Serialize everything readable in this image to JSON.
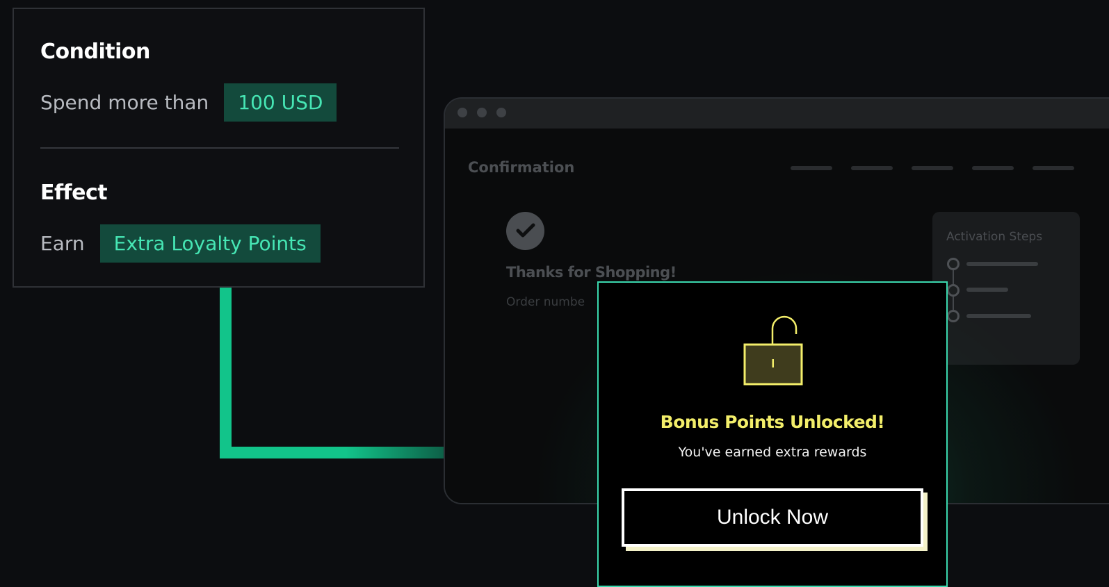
{
  "rule": {
    "condition_heading": "Condition",
    "condition_text": "Spend more than",
    "condition_value": "100 USD",
    "effect_heading": "Effect",
    "effect_text": "Earn",
    "effect_value": "Extra Loyalty Points"
  },
  "browser": {
    "page_title": "Confirmation",
    "confirmation_icon": "check-icon",
    "thanks_message": "Thanks for Shopping!",
    "order_label": "Order numbe",
    "steps_panel": {
      "title": "Activation Steps"
    }
  },
  "modal": {
    "icon": "unlocked-padlock-icon",
    "title": "Bonus Points Unlocked!",
    "subtitle": "You've earned extra rewards",
    "button_label": "Unlock Now"
  },
  "colors": {
    "background": "#0c0d10",
    "accent_green": "#12c48a",
    "chip_bg": "#134a3c",
    "chip_text": "#46e6b4",
    "modal_border": "#3bd8ae",
    "modal_title": "#f3ee6a",
    "button_shadow": "#f4f2c9"
  }
}
